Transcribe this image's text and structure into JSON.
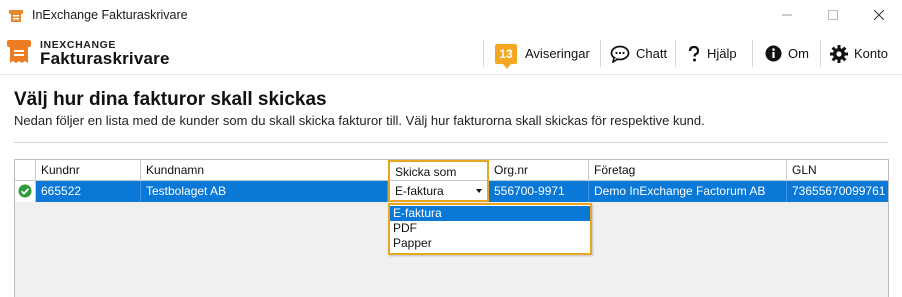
{
  "window": {
    "title": "InExchange Fakturaskrivare"
  },
  "logo": {
    "brand": "INEXCHANGE",
    "product": "Fakturaskrivare"
  },
  "nav": {
    "notifications_count": "13",
    "notifications_label": "Aviseringar",
    "chat_label": "Chatt",
    "help_label": "Hjälp",
    "about_label": "Om",
    "account_label": "Konto"
  },
  "colors": {
    "accent": "#f5a623",
    "selection": "#0a78d7",
    "status_ok": "#2e9b3a"
  },
  "page": {
    "title": "Välj hur dina fakturor skall skickas",
    "description": "Nedan följer en lista med de kunder som du skall skicka fakturor till. Välj hur fakturorna skall skickas för respektive kund."
  },
  "grid": {
    "columns": [
      "Kundnr",
      "Kundnamn",
      "Skicka som",
      "Org.nr",
      "Företag",
      "GLN"
    ],
    "rows": [
      {
        "status_icon": "check-circle-icon",
        "cells": [
          "665522",
          "Testbolaget AB",
          "E-faktura",
          "556700-9971",
          "Demo InExchange Factorum AB",
          "73655670099761"
        ]
      }
    ]
  },
  "dropdown": {
    "options": [
      "E-faktura",
      "PDF",
      "Papper"
    ],
    "selected": "E-faktura"
  }
}
